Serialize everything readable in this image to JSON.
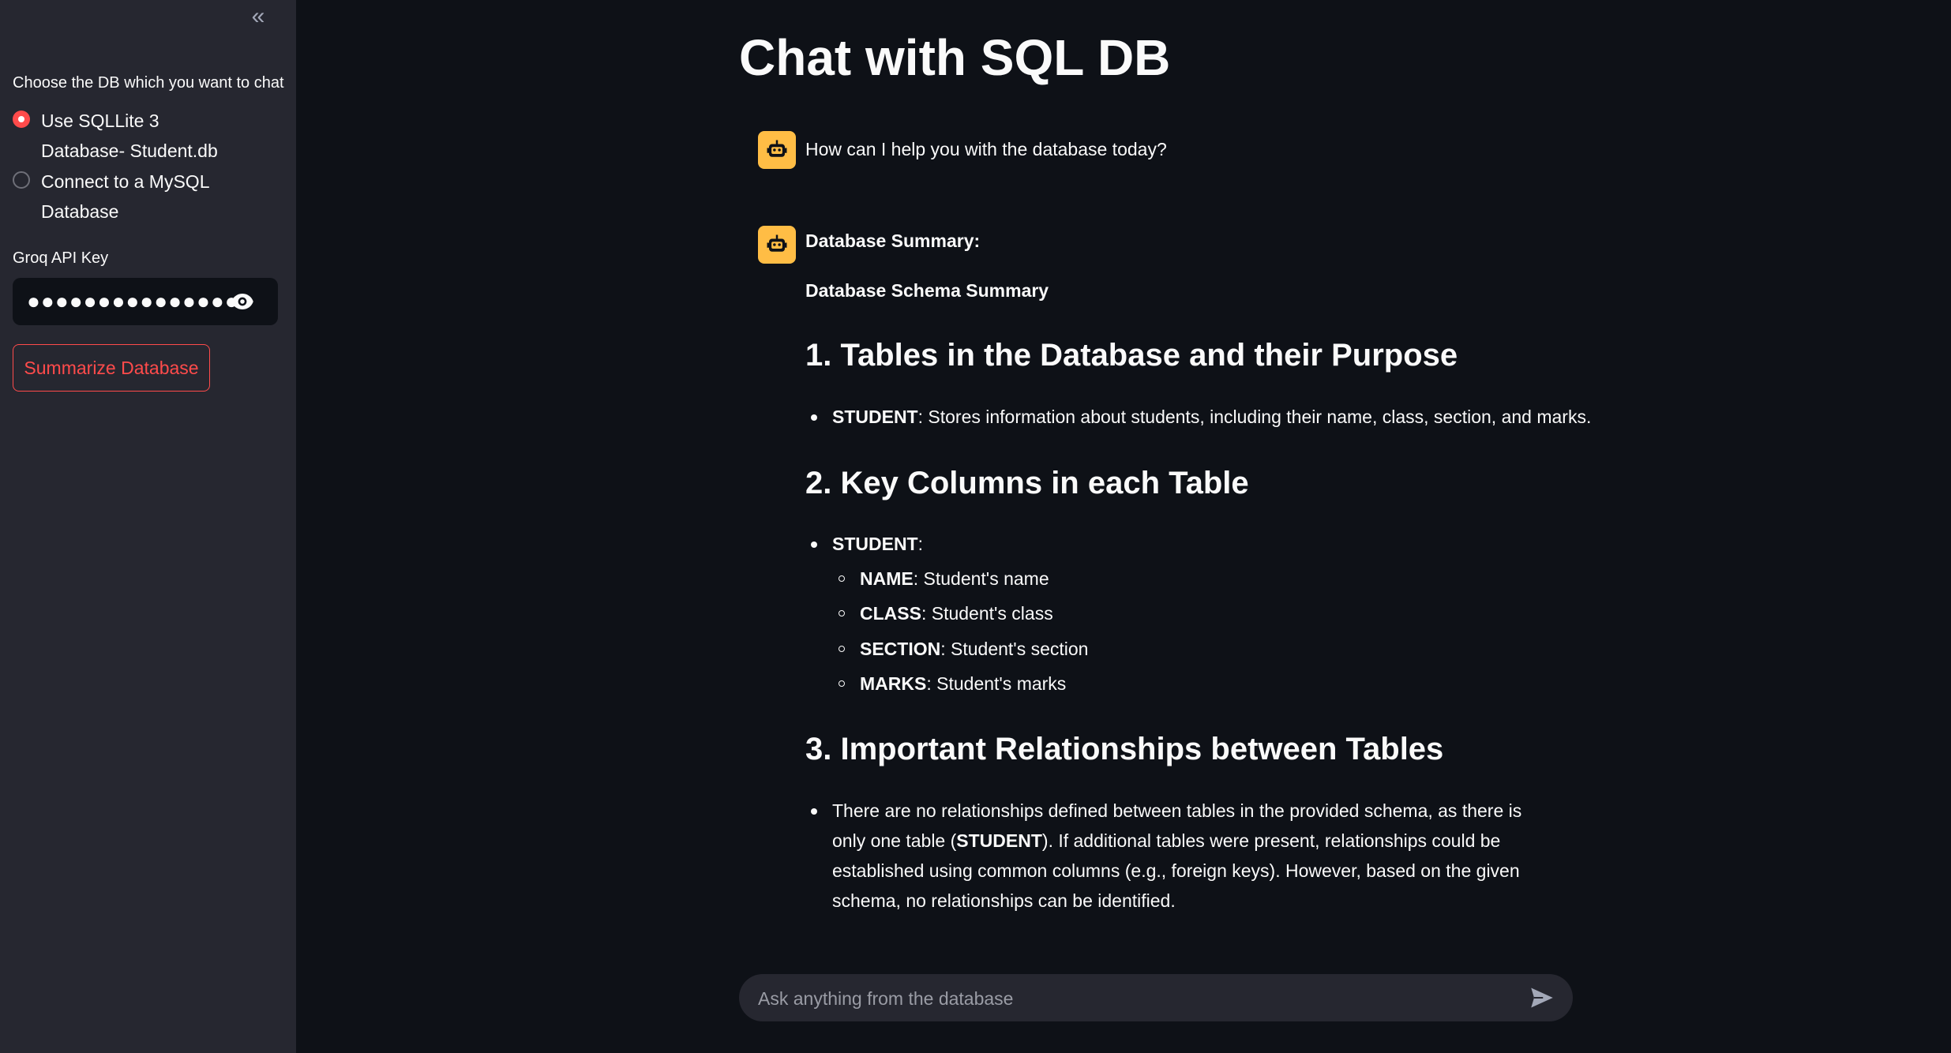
{
  "sidebar": {
    "collapse_icon": "«",
    "radio_label": "Choose the DB which you want to chat",
    "radio_options": [
      {
        "label": "Use SQLLite 3 Database- Student.db",
        "selected": true
      },
      {
        "label": "Connect to a MySQL Database",
        "selected": false
      }
    ],
    "api_key_label": "Groq API Key",
    "api_key_value": "●●●●●●●●●●●●●●●●",
    "summarize_button": "Summarize Database"
  },
  "main": {
    "title": "Chat with SQL DB",
    "messages": {
      "greeting": "How can I help you with the database today?",
      "summary_heading": "Database Summary:",
      "schema_title": "Database Schema Summary",
      "h1": "1. Tables in the Database and their Purpose",
      "h1_item_bold": "STUDENT",
      "h1_item_text": ": Stores information about students, including their name, class, section, and marks.",
      "h2": "2. Key Columns in each Table",
      "h2_item_bold": "STUDENT",
      "h2_item_text": ":",
      "columns": [
        {
          "name": "NAME",
          "desc": ": Student's name"
        },
        {
          "name": "CLASS",
          "desc": ": Student's class"
        },
        {
          "name": "SECTION",
          "desc": ": Student's section"
        },
        {
          "name": "MARKS",
          "desc": ": Student's marks"
        }
      ],
      "h3": "3. Important Relationships between Tables",
      "h3_text_a": "There are no relationships defined between tables in the provided schema, as there is only one table (",
      "h3_text_bold": "STUDENT",
      "h3_text_b": "). If additional tables were present, relationships could be established using common columns (e.g., foreign keys). However, based on the given schema, no relationships can be identified."
    },
    "chat_input_placeholder": "Ask anything from the database"
  },
  "colors": {
    "accent": "#ff4b4b",
    "avatar": "#ffbd45",
    "background": "#0e1117",
    "sidebar": "#262730"
  },
  "icons": {
    "collapse": "chevron-double-left-icon",
    "eye": "eye-icon",
    "bot": "robot-icon",
    "send": "send-icon"
  }
}
